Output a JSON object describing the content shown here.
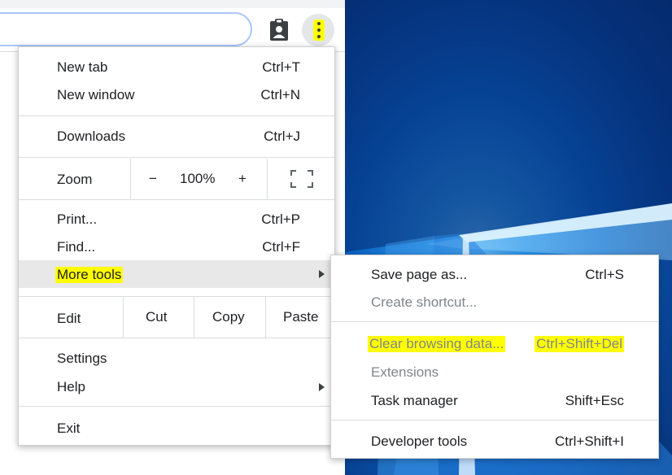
{
  "menu": {
    "items": [
      {
        "label": "New tab",
        "shortcut": "Ctrl+T"
      },
      {
        "label": "New window",
        "shortcut": "Ctrl+N"
      },
      {
        "label": "Downloads",
        "shortcut": "Ctrl+J"
      },
      {
        "label": "Print...",
        "shortcut": "Ctrl+P"
      },
      {
        "label": "Find...",
        "shortcut": "Ctrl+F"
      },
      {
        "label": "More tools"
      },
      {
        "label": "Settings"
      },
      {
        "label": "Help"
      },
      {
        "label": "Exit"
      }
    ],
    "zoom": {
      "label": "Zoom",
      "minus": "−",
      "value": "100%",
      "plus": "+"
    },
    "edit": {
      "label": "Edit",
      "cut": "Cut",
      "copy": "Copy",
      "paste": "Paste"
    }
  },
  "submenu": {
    "items": [
      {
        "label": "Save page as...",
        "shortcut": "Ctrl+S"
      },
      {
        "label": "Create shortcut..."
      },
      {
        "label": "Clear browsing data...",
        "shortcut": "Ctrl+Shift+Del"
      },
      {
        "label": "Extensions"
      },
      {
        "label": "Task manager",
        "shortcut": "Shift+Esc"
      },
      {
        "label": "Developer tools",
        "shortcut": "Ctrl+Shift+I"
      }
    ]
  },
  "colors": {
    "highlight": "#ffff00",
    "hover_background": "#e8e8e8",
    "disabled_text": "#80868b"
  },
  "icons": [
    "account-badge-icon",
    "vertical-dots-icon",
    "fullscreen-icon",
    "submenu-arrow-icon"
  ]
}
